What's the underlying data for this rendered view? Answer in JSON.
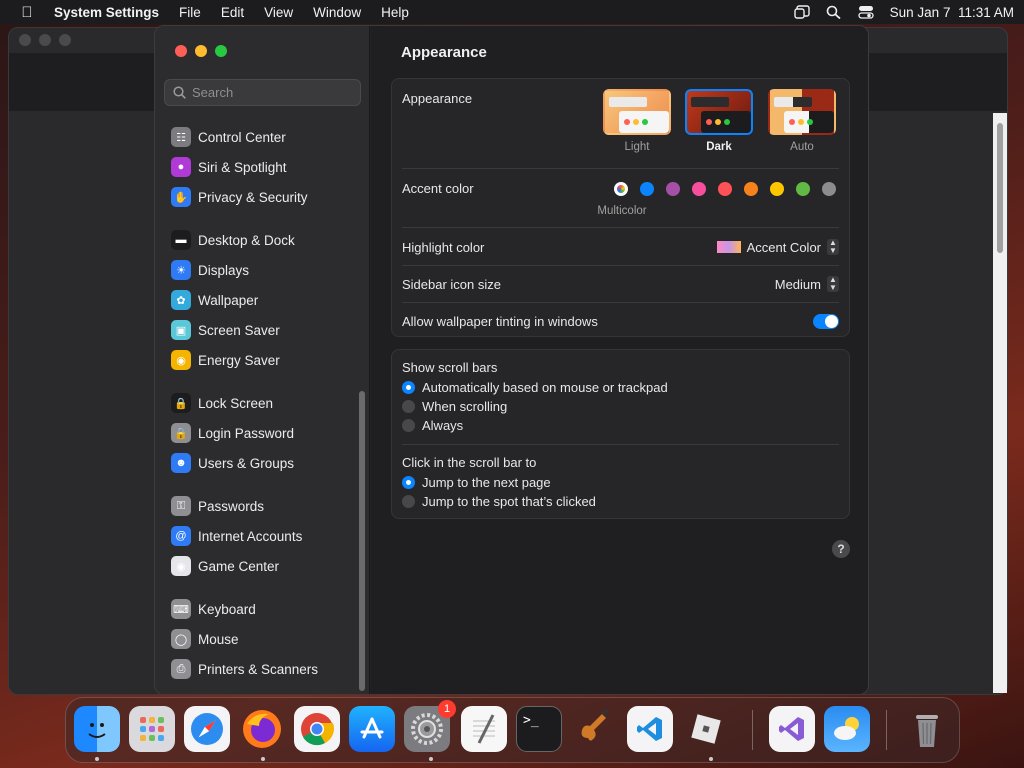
{
  "menubar": {
    "app_name": "System Settings",
    "items": [
      "File",
      "Edit",
      "View",
      "Window",
      "Help"
    ],
    "datetime": "Sun Jan 7  11:31 AM"
  },
  "sidebar": {
    "search_placeholder": "Search",
    "items": [
      {
        "label": "Control Center",
        "icon": "control-center-icon",
        "color": "#7c7c80"
      },
      {
        "label": "Siri & Spotlight",
        "icon": "siri-icon",
        "color": "#b03ad6"
      },
      {
        "label": "Privacy & Security",
        "icon": "hand-icon",
        "color": "#2f7bf6"
      },
      {
        "label": "Desktop & Dock",
        "icon": "dock-icon",
        "color": "#1c1c1e"
      },
      {
        "label": "Displays",
        "icon": "sun-icon",
        "color": "#2f7bf6"
      },
      {
        "label": "Wallpaper",
        "icon": "wallpaper-icon",
        "color": "#34aadc"
      },
      {
        "label": "Screen Saver",
        "icon": "screen-saver-icon",
        "color": "#5ac8d8"
      },
      {
        "label": "Energy Saver",
        "icon": "lightbulb-icon",
        "color": "#f5b400"
      },
      {
        "label": "Lock Screen",
        "icon": "lock-icon",
        "color": "#1c1c1e"
      },
      {
        "label": "Login Password",
        "icon": "lock-icon",
        "color": "#8e8e93"
      },
      {
        "label": "Users & Groups",
        "icon": "users-icon",
        "color": "#2f7bf6"
      },
      {
        "label": "Passwords",
        "icon": "key-icon",
        "color": "#8e8e93"
      },
      {
        "label": "Internet Accounts",
        "icon": "at-icon",
        "color": "#2f7bf6"
      },
      {
        "label": "Game Center",
        "icon": "game-center-icon",
        "color": "#e5e5ea"
      },
      {
        "label": "Keyboard",
        "icon": "keyboard-icon",
        "color": "#8e8e93"
      },
      {
        "label": "Mouse",
        "icon": "mouse-icon",
        "color": "#8e8e93"
      },
      {
        "label": "Printers & Scanners",
        "icon": "printer-icon",
        "color": "#8e8e93"
      }
    ]
  },
  "main": {
    "title": "Appearance",
    "appearance": {
      "label": "Appearance",
      "options": [
        "Light",
        "Dark",
        "Auto"
      ],
      "selected": "Dark"
    },
    "accent": {
      "label": "Accent color",
      "caption": "Multicolor",
      "colors": [
        "#0a84ff",
        "#a550a7",
        "#f74f9e",
        "#ff5257",
        "#f7821b",
        "#ffc600",
        "#62ba46",
        "#8c8c8c"
      ]
    },
    "highlight": {
      "label": "Highlight color",
      "value": "Accent Color"
    },
    "sidebar_icon_size": {
      "label": "Sidebar icon size",
      "value": "Medium"
    },
    "wallpaper_tinting": {
      "label": "Allow wallpaper tinting in windows",
      "on": true
    },
    "scroll_bars": {
      "label": "Show scroll bars",
      "options": [
        "Automatically based on mouse or trackpad",
        "When scrolling",
        "Always"
      ],
      "selected": 0
    },
    "click_scroll": {
      "label": "Click in the scroll bar to",
      "options": [
        "Jump to the next page",
        "Jump to the spot that’s clicked"
      ],
      "selected": 0
    },
    "help": "?"
  },
  "dock": {
    "settings_badge": "1"
  }
}
